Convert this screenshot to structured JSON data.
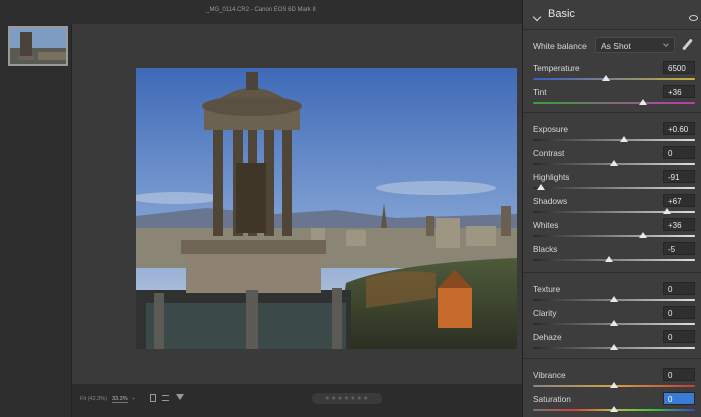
{
  "title_bar": {
    "text": "_MG_0114.CR2 - Canon EOS 6D Mark II"
  },
  "filmstrip": {
    "selected_index": 0
  },
  "bottom_toolbar": {
    "fit_label": "Fit (42.3%)",
    "zoom_value": "33.3%",
    "zoom_arrow": "÷",
    "stars": "★★★★★★★"
  },
  "panel": {
    "title": "Basic",
    "white_balance": {
      "label": "White balance",
      "value": "As Shot"
    },
    "sliders": [
      {
        "label": "Temperature",
        "value": "6500",
        "position": 0.45,
        "track": "temperature"
      },
      {
        "label": "Tint",
        "value": "+36",
        "position": 0.68,
        "track": "tint"
      },
      {
        "label": "Exposure",
        "value": "+0.60",
        "position": 0.56,
        "track": "neutral"
      },
      {
        "label": "Contrast",
        "value": "0",
        "position": 0.5,
        "track": "neutral"
      },
      {
        "label": "Highlights",
        "value": "-91",
        "position": 0.05,
        "track": "neutral"
      },
      {
        "label": "Shadows",
        "value": "+67",
        "position": 0.83,
        "track": "neutral"
      },
      {
        "label": "Whites",
        "value": "+36",
        "position": 0.68,
        "track": "neutral"
      },
      {
        "label": "Blacks",
        "value": "-5",
        "position": 0.47,
        "track": "neutral"
      },
      {
        "label": "Texture",
        "value": "0",
        "position": 0.5,
        "track": "neutral"
      },
      {
        "label": "Clarity",
        "value": "0",
        "position": 0.5,
        "track": "neutral"
      },
      {
        "label": "Dehaze",
        "value": "0",
        "position": 0.5,
        "track": "neutral"
      },
      {
        "label": "Vibrance",
        "value": "0",
        "position": 0.5,
        "track": "vibrance"
      },
      {
        "label": "Saturation",
        "value": "0",
        "position": 0.5,
        "track": "saturation"
      }
    ]
  },
  "colors": {
    "accent": "#3a7bd5",
    "panel_bg": "#3d3d3d",
    "canvas_bg": "#3a3a3a"
  }
}
